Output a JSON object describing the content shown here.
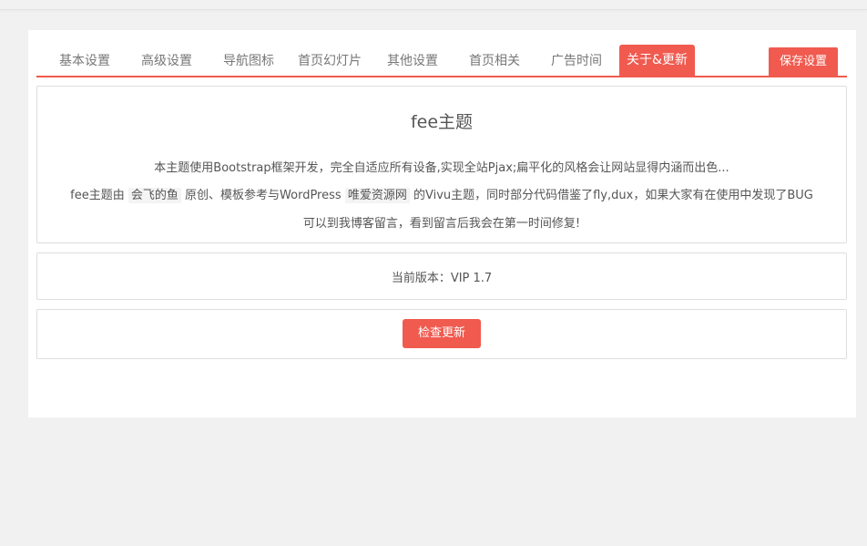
{
  "tabs": [
    {
      "label": "基本设置"
    },
    {
      "label": "高级设置"
    },
    {
      "label": "导航图标"
    },
    {
      "label": "首页幻灯片"
    },
    {
      "label": "其他设置"
    },
    {
      "label": "首页相关"
    },
    {
      "label": "广告时间"
    },
    {
      "label": "关于&更新"
    }
  ],
  "active_tab": "关于&更新",
  "save_label": "保存设置",
  "about": {
    "title": "fee主题",
    "line1": "本主题使用Bootstrap框架开发，完全自适应所有设备,实现全站Pjax;扁平化的风格会让网站显得内涵而出色...",
    "line2_a": "fee主题由",
    "author": "会飞的鱼",
    "line2_b": "原创、模板参考与WordPress",
    "source_site": "唯爱资源网",
    "line2_c": "的Vivu主题，同时部分代码借鉴了fly,dux，如果大家有在使用中发现了BUG",
    "line3": "可以到我博客留言，看到留言后我会在第一时间修复!"
  },
  "version_text": "当前版本：VIP 1.7",
  "check_update_label": "检查更新",
  "colors": {
    "accent": "#f05a4f",
    "page_bg": "#f1f1f1",
    "panel_bg": "#ffffff"
  }
}
